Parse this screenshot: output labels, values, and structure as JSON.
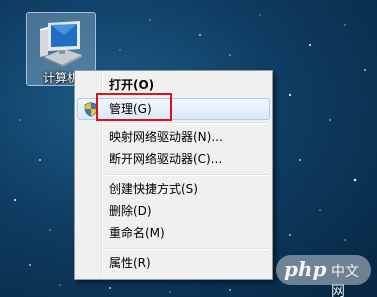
{
  "desktop": {
    "icon": {
      "label": "计算机",
      "icon_name": "computer-icon"
    }
  },
  "context_menu": {
    "items": [
      {
        "label": "打开(O)",
        "bold": true
      },
      {
        "label": "管理(G)",
        "icon": "shield-icon",
        "state": "hover",
        "highlighted": true
      },
      {
        "label": "映射网络驱动器(N)..."
      },
      {
        "label": "断开网络驱动器(C)..."
      },
      {
        "label": "创建快捷方式(S)"
      },
      {
        "label": "删除(D)"
      },
      {
        "label": "重命名(M)"
      },
      {
        "label": "属性(R)"
      }
    ],
    "highlight_color": "#d8131a",
    "hover_color": "#dbe8f8"
  },
  "watermark": {
    "mark": "php",
    "text": "中文网"
  }
}
